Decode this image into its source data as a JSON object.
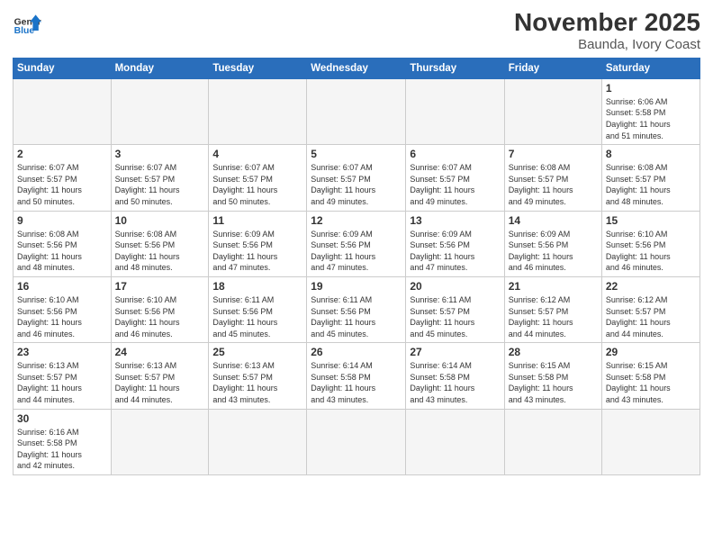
{
  "header": {
    "logo_general": "General",
    "logo_blue": "Blue",
    "month_title": "November 2025",
    "location": "Baunda, Ivory Coast"
  },
  "weekdays": [
    "Sunday",
    "Monday",
    "Tuesday",
    "Wednesday",
    "Thursday",
    "Friday",
    "Saturday"
  ],
  "weeks": [
    [
      {
        "day": "",
        "info": ""
      },
      {
        "day": "",
        "info": ""
      },
      {
        "day": "",
        "info": ""
      },
      {
        "day": "",
        "info": ""
      },
      {
        "day": "",
        "info": ""
      },
      {
        "day": "",
        "info": ""
      },
      {
        "day": "1",
        "info": "Sunrise: 6:06 AM\nSunset: 5:58 PM\nDaylight: 11 hours\nand 51 minutes."
      }
    ],
    [
      {
        "day": "2",
        "info": "Sunrise: 6:07 AM\nSunset: 5:57 PM\nDaylight: 11 hours\nand 50 minutes."
      },
      {
        "day": "3",
        "info": "Sunrise: 6:07 AM\nSunset: 5:57 PM\nDaylight: 11 hours\nand 50 minutes."
      },
      {
        "day": "4",
        "info": "Sunrise: 6:07 AM\nSunset: 5:57 PM\nDaylight: 11 hours\nand 50 minutes."
      },
      {
        "day": "5",
        "info": "Sunrise: 6:07 AM\nSunset: 5:57 PM\nDaylight: 11 hours\nand 49 minutes."
      },
      {
        "day": "6",
        "info": "Sunrise: 6:07 AM\nSunset: 5:57 PM\nDaylight: 11 hours\nand 49 minutes."
      },
      {
        "day": "7",
        "info": "Sunrise: 6:08 AM\nSunset: 5:57 PM\nDaylight: 11 hours\nand 49 minutes."
      },
      {
        "day": "8",
        "info": "Sunrise: 6:08 AM\nSunset: 5:57 PM\nDaylight: 11 hours\nand 48 minutes."
      }
    ],
    [
      {
        "day": "9",
        "info": "Sunrise: 6:08 AM\nSunset: 5:56 PM\nDaylight: 11 hours\nand 48 minutes."
      },
      {
        "day": "10",
        "info": "Sunrise: 6:08 AM\nSunset: 5:56 PM\nDaylight: 11 hours\nand 48 minutes."
      },
      {
        "day": "11",
        "info": "Sunrise: 6:09 AM\nSunset: 5:56 PM\nDaylight: 11 hours\nand 47 minutes."
      },
      {
        "day": "12",
        "info": "Sunrise: 6:09 AM\nSunset: 5:56 PM\nDaylight: 11 hours\nand 47 minutes."
      },
      {
        "day": "13",
        "info": "Sunrise: 6:09 AM\nSunset: 5:56 PM\nDaylight: 11 hours\nand 47 minutes."
      },
      {
        "day": "14",
        "info": "Sunrise: 6:09 AM\nSunset: 5:56 PM\nDaylight: 11 hours\nand 46 minutes."
      },
      {
        "day": "15",
        "info": "Sunrise: 6:10 AM\nSunset: 5:56 PM\nDaylight: 11 hours\nand 46 minutes."
      }
    ],
    [
      {
        "day": "16",
        "info": "Sunrise: 6:10 AM\nSunset: 5:56 PM\nDaylight: 11 hours\nand 46 minutes."
      },
      {
        "day": "17",
        "info": "Sunrise: 6:10 AM\nSunset: 5:56 PM\nDaylight: 11 hours\nand 46 minutes."
      },
      {
        "day": "18",
        "info": "Sunrise: 6:11 AM\nSunset: 5:56 PM\nDaylight: 11 hours\nand 45 minutes."
      },
      {
        "day": "19",
        "info": "Sunrise: 6:11 AM\nSunset: 5:56 PM\nDaylight: 11 hours\nand 45 minutes."
      },
      {
        "day": "20",
        "info": "Sunrise: 6:11 AM\nSunset: 5:57 PM\nDaylight: 11 hours\nand 45 minutes."
      },
      {
        "day": "21",
        "info": "Sunrise: 6:12 AM\nSunset: 5:57 PM\nDaylight: 11 hours\nand 44 minutes."
      },
      {
        "day": "22",
        "info": "Sunrise: 6:12 AM\nSunset: 5:57 PM\nDaylight: 11 hours\nand 44 minutes."
      }
    ],
    [
      {
        "day": "23",
        "info": "Sunrise: 6:13 AM\nSunset: 5:57 PM\nDaylight: 11 hours\nand 44 minutes."
      },
      {
        "day": "24",
        "info": "Sunrise: 6:13 AM\nSunset: 5:57 PM\nDaylight: 11 hours\nand 44 minutes."
      },
      {
        "day": "25",
        "info": "Sunrise: 6:13 AM\nSunset: 5:57 PM\nDaylight: 11 hours\nand 43 minutes."
      },
      {
        "day": "26",
        "info": "Sunrise: 6:14 AM\nSunset: 5:58 PM\nDaylight: 11 hours\nand 43 minutes."
      },
      {
        "day": "27",
        "info": "Sunrise: 6:14 AM\nSunset: 5:58 PM\nDaylight: 11 hours\nand 43 minutes."
      },
      {
        "day": "28",
        "info": "Sunrise: 6:15 AM\nSunset: 5:58 PM\nDaylight: 11 hours\nand 43 minutes."
      },
      {
        "day": "29",
        "info": "Sunrise: 6:15 AM\nSunset: 5:58 PM\nDaylight: 11 hours\nand 43 minutes."
      }
    ],
    [
      {
        "day": "30",
        "info": "Sunrise: 6:16 AM\nSunset: 5:58 PM\nDaylight: 11 hours\nand 42 minutes."
      },
      {
        "day": "",
        "info": ""
      },
      {
        "day": "",
        "info": ""
      },
      {
        "day": "",
        "info": ""
      },
      {
        "day": "",
        "info": ""
      },
      {
        "day": "",
        "info": ""
      },
      {
        "day": "",
        "info": ""
      }
    ]
  ]
}
